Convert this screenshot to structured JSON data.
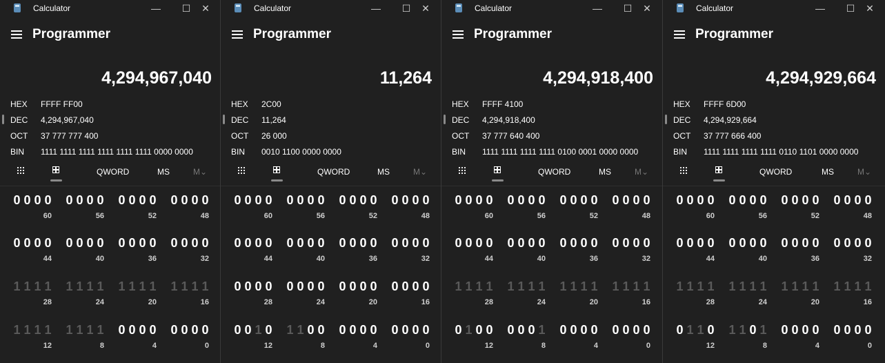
{
  "common": {
    "app_title": "Calculator",
    "mode_title": "Programmer",
    "minimize_glyph": "—",
    "maximize_glyph": "☐",
    "close_glyph": "✕",
    "radix_labels": [
      "HEX",
      "DEC",
      "OCT",
      "BIN"
    ],
    "toolbar": {
      "word_size": "QWORD",
      "memory_store": "MS",
      "memory_menu": "M⌄"
    },
    "bit_positions": [
      [
        "60",
        "56",
        "52",
        "48"
      ],
      [
        "44",
        "40",
        "36",
        "32"
      ],
      [
        "28",
        "24",
        "20",
        "16"
      ],
      [
        "12",
        "8",
        "4",
        "0"
      ]
    ],
    "colors": {
      "background": "#202020",
      "active_bit": "#ffffff",
      "dim_bit": "#5a5a5a",
      "marker": "#8a8a8a"
    }
  },
  "windows": [
    {
      "display": "4,294,967,040",
      "hex": "FFFF FF00",
      "dec": "4,294,967,040",
      "oct": "37 777 777 400",
      "bin": "1111 1111 1111 1111 1111 1111 0000 0000",
      "bit_rows": [
        [
          "0000",
          "0000",
          "0000",
          "0000"
        ],
        [
          "0000",
          "0000",
          "0000",
          "0000"
        ],
        [
          "1111",
          "1111",
          "1111",
          "1111"
        ],
        [
          "1111",
          "1111",
          "0000",
          "0000"
        ]
      ]
    },
    {
      "display": "11,264",
      "hex": "2C00",
      "dec": "11,264",
      "oct": "26 000",
      "bin": "0010 1100 0000 0000",
      "bit_rows": [
        [
          "0000",
          "0000",
          "0000",
          "0000"
        ],
        [
          "0000",
          "0000",
          "0000",
          "0000"
        ],
        [
          "0000",
          "0000",
          "0000",
          "0000"
        ],
        [
          "0010",
          "1100",
          "0000",
          "0000"
        ]
      ]
    },
    {
      "display": "4,294,918,400",
      "hex": "FFFF 4100",
      "dec": "4,294,918,400",
      "oct": "37 777 640 400",
      "bin": "1111 1111 1111 1111 0100 0001 0000 0000",
      "bit_rows": [
        [
          "0000",
          "0000",
          "0000",
          "0000"
        ],
        [
          "0000",
          "0000",
          "0000",
          "0000"
        ],
        [
          "1111",
          "1111",
          "1111",
          "1111"
        ],
        [
          "0100",
          "0001",
          "0000",
          "0000"
        ]
      ]
    },
    {
      "display": "4,294,929,664",
      "hex": "FFFF 6D00",
      "dec": "4,294,929,664",
      "oct": "37 777 666 400",
      "bin": "1111 1111 1111 1111 0110 1101 0000 0000",
      "bit_rows": [
        [
          "0000",
          "0000",
          "0000",
          "0000"
        ],
        [
          "0000",
          "0000",
          "0000",
          "0000"
        ],
        [
          "1111",
          "1111",
          "1111",
          "1111"
        ],
        [
          "0110",
          "1101",
          "0000",
          "0000"
        ]
      ]
    }
  ]
}
